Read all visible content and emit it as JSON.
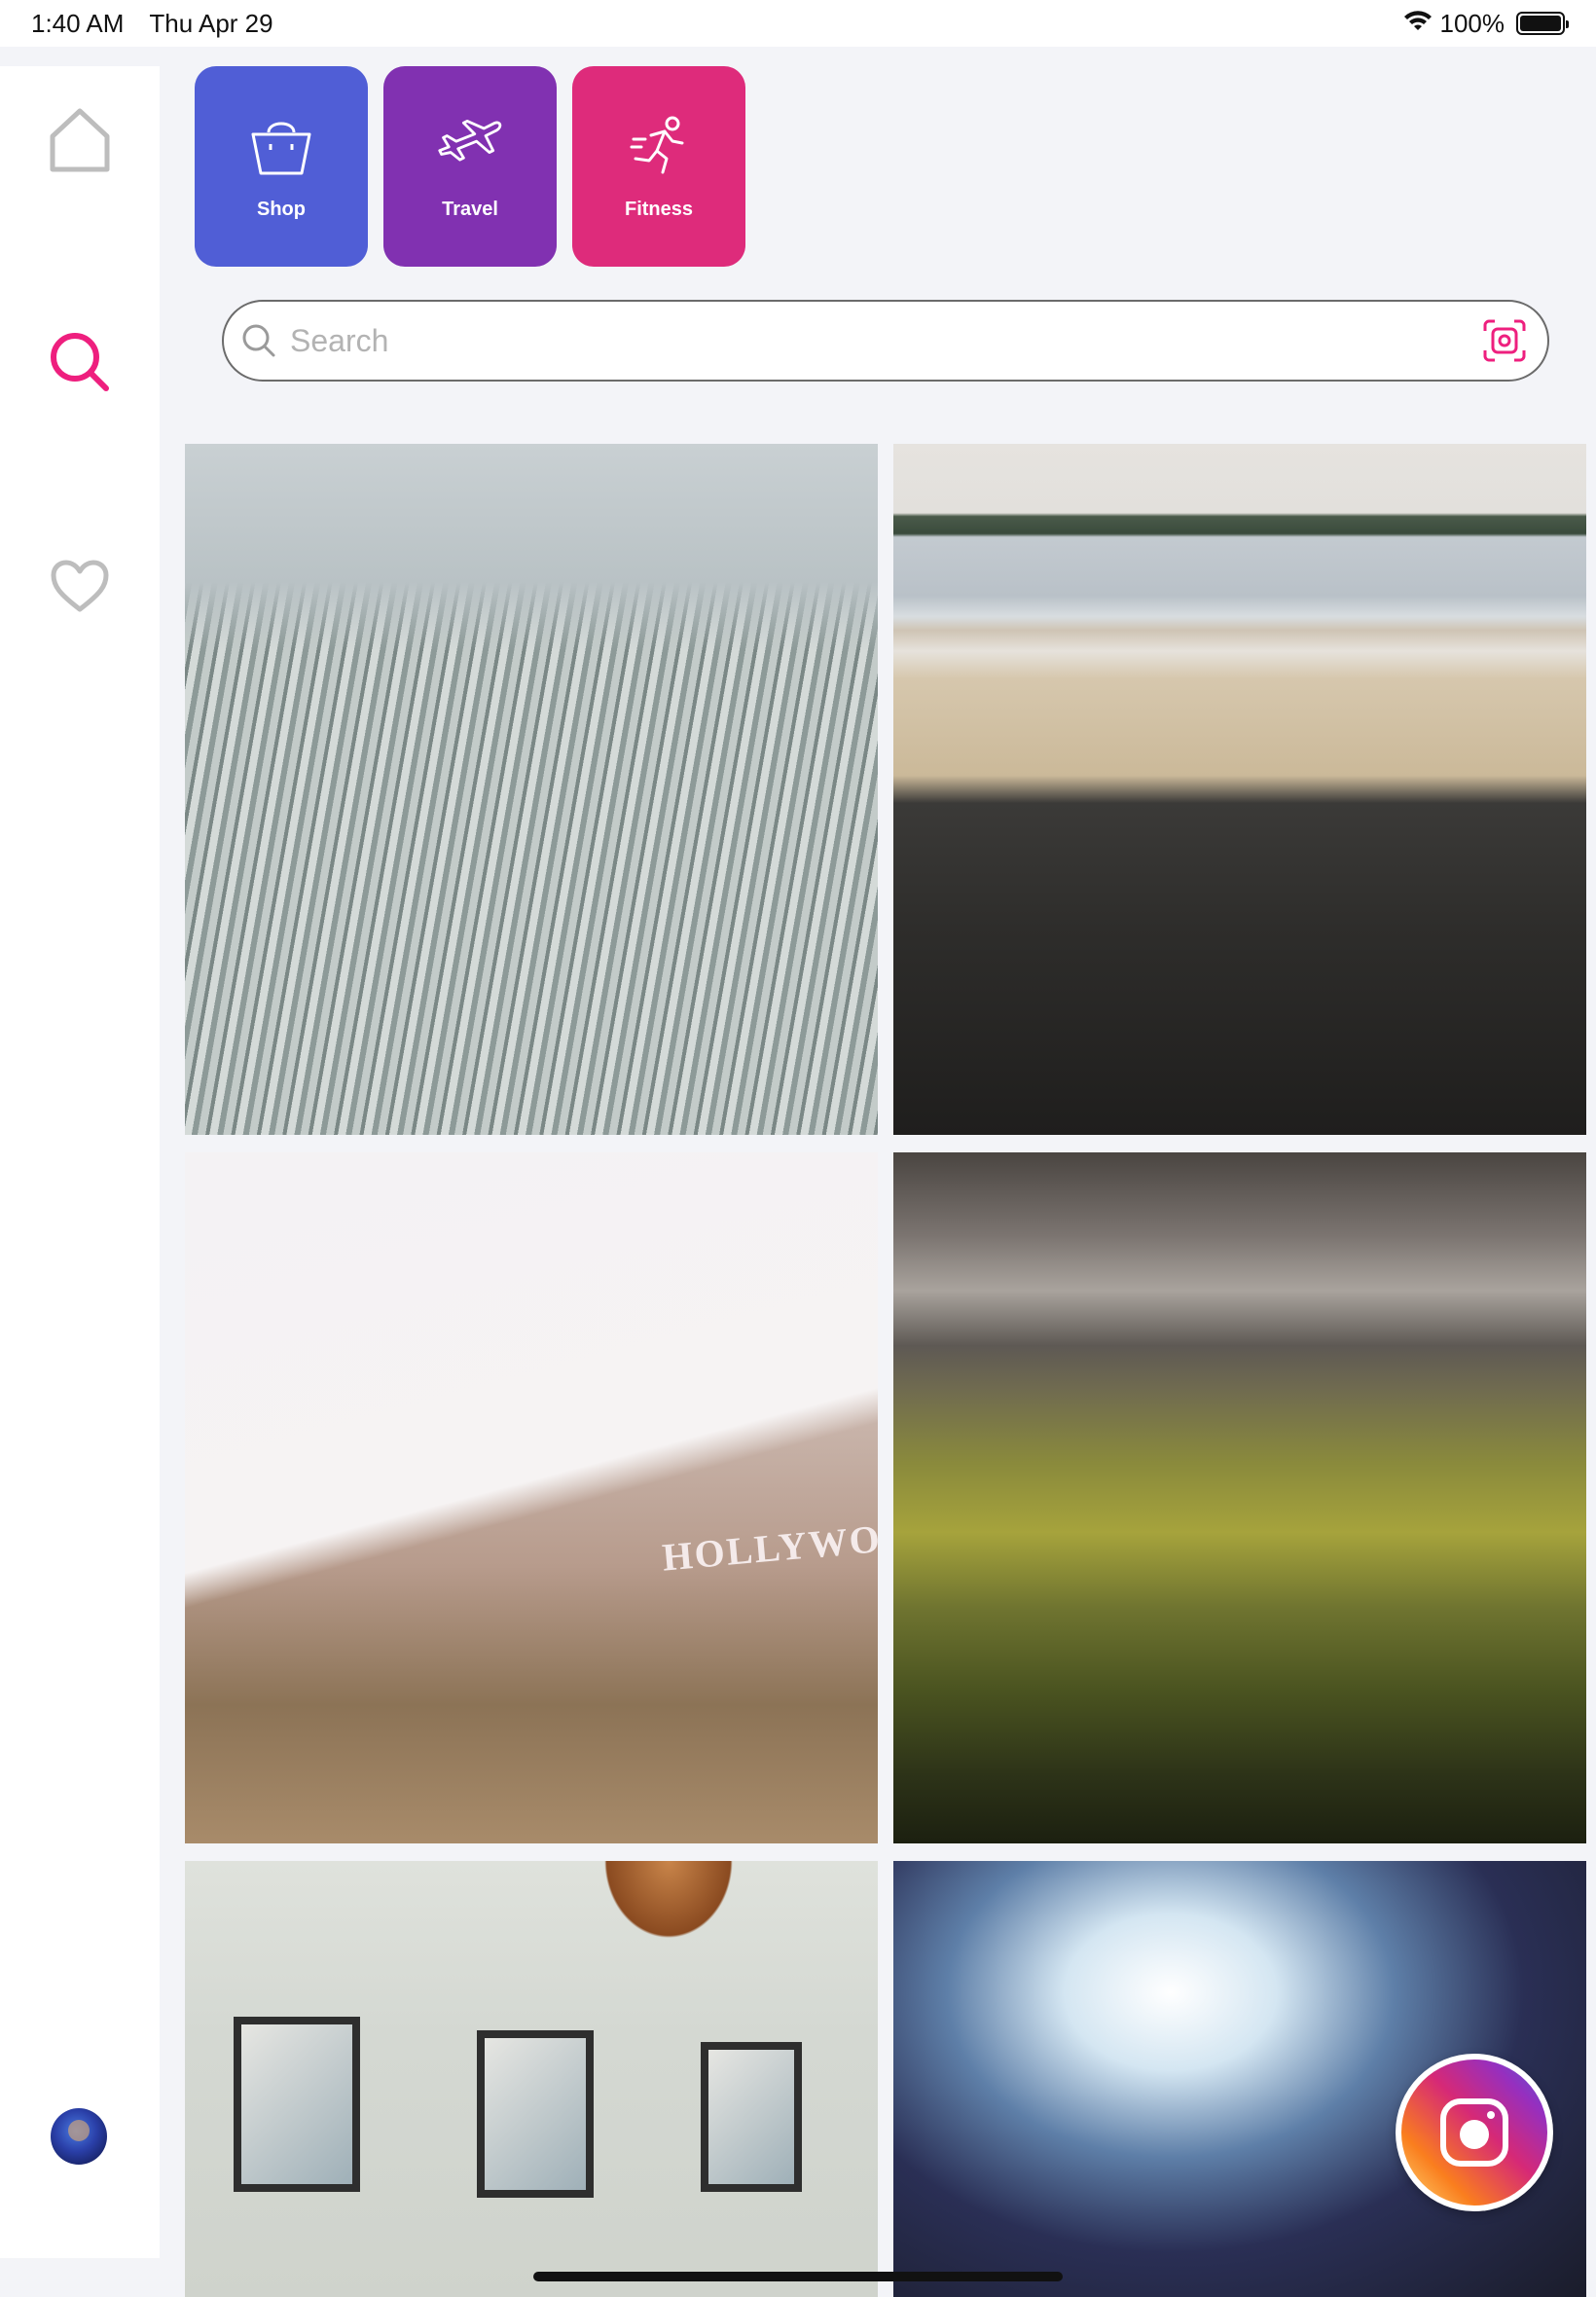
{
  "status_bar": {
    "time": "1:40 AM",
    "date": "Thu Apr 29",
    "battery_text": "100%",
    "battery_level": 1.0
  },
  "sidebar": {
    "items": [
      {
        "name": "home",
        "icon": "home-icon",
        "active": false
      },
      {
        "name": "search",
        "icon": "search-icon",
        "active": true
      },
      {
        "name": "favorites",
        "icon": "heart-icon",
        "active": false
      }
    ],
    "profile": {
      "icon": "avatar"
    }
  },
  "categories": [
    {
      "label": "Shop",
      "icon": "shopping-bag-icon",
      "color": "#505ed6"
    },
    {
      "label": "Travel",
      "icon": "airplane-icon",
      "color": "#8131b1"
    },
    {
      "label": "Fitness",
      "icon": "running-person-icon",
      "color": "#de2b7b"
    }
  ],
  "search": {
    "value": "",
    "placeholder": "Search",
    "scan_icon": "scan-icon"
  },
  "photos": [
    {
      "description_icon": "photo-snowy-forest"
    },
    {
      "description_icon": "photo-beach-rocks"
    },
    {
      "description_icon": "photo-hollywood-hills",
      "sign_text": "HOLLYWOOD"
    },
    {
      "description_icon": "photo-green-valley"
    },
    {
      "description_icon": "photo-framed-pictures"
    },
    {
      "description_icon": "photo-abstract-blur"
    }
  ],
  "fab": {
    "icon": "camera-icon"
  },
  "colors": {
    "accent": "#ee1f7e",
    "inactive_icon": "#bdbdbd",
    "background": "#f3f4f8"
  }
}
